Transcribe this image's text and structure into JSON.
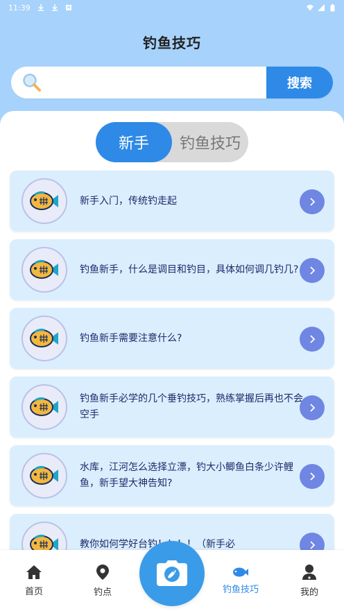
{
  "status_bar": {
    "time": "11:39"
  },
  "header": {
    "title": "钓鱼技巧"
  },
  "search": {
    "placeholder": "",
    "button_label": "搜索"
  },
  "tabs": [
    {
      "label": "新手",
      "active": true
    },
    {
      "label": "钓鱼技巧",
      "active": false
    }
  ],
  "articles": [
    {
      "title": "新手入门，传统钓走起"
    },
    {
      "title": "钓鱼新手，什么是调目和钓目，具体如何调几钓几?"
    },
    {
      "title": "钓鱼新手需要注意什么?"
    },
    {
      "title": "钓鱼新手必学的几个垂钓技巧，熟练掌握后再也不会空手"
    },
    {
      "title": "水库，江河怎么选择立漂，钓大小鲫鱼白条少许鲤鱼，新手望大神告知?"
    },
    {
      "title": "教你如何学好台钓！！！！（新手必"
    }
  ],
  "bottom_nav": {
    "home": "首页",
    "spots": "钓点",
    "tips": "钓鱼技巧",
    "mine": "我的"
  },
  "colors": {
    "accent": "#2e8ae6",
    "header_bg": "#a7d2fb",
    "card_bg": "#dbeefd",
    "arrow": "#6f86e2"
  }
}
